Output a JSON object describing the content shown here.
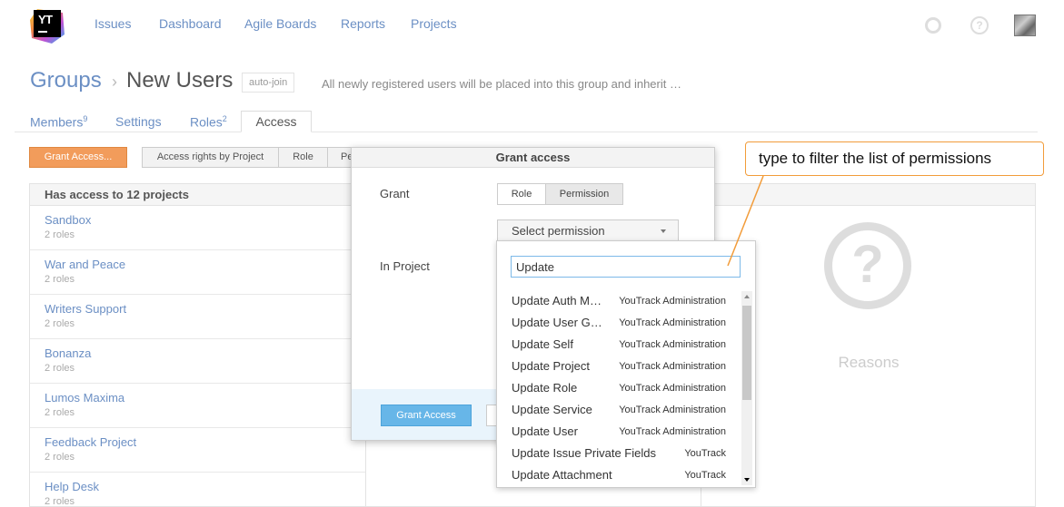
{
  "header": {
    "logo_text": "YT",
    "nav": [
      "Issues",
      "Dashboard",
      "Agile Boards",
      "Reports",
      "Projects"
    ]
  },
  "breadcrumb": {
    "parent": "Groups",
    "separator": "›",
    "current": "New Users",
    "badge": "auto-join",
    "description": "All newly registered users will be placed into this group and inherit …"
  },
  "tabs": {
    "members": "Members",
    "members_count": "9",
    "settings": "Settings",
    "roles": "Roles",
    "roles_count": "2",
    "access": "Access"
  },
  "toolbar": {
    "grant_button": "Grant Access...",
    "segments": [
      "Access rights by Project",
      "Role",
      "Pe"
    ]
  },
  "projects_panel": {
    "heading": "Has access to 12 projects",
    "items": [
      {
        "name": "Sandbox",
        "roles": "2 roles"
      },
      {
        "name": "War and Peace",
        "roles": "2 roles"
      },
      {
        "name": "Writers Support",
        "roles": "2 roles"
      },
      {
        "name": "Bonanza",
        "roles": "2 roles"
      },
      {
        "name": "Lumos Maxima",
        "roles": "2 roles"
      },
      {
        "name": "Feedback Project",
        "roles": "2 roles"
      },
      {
        "name": "Help Desk",
        "roles": "2 roles"
      }
    ]
  },
  "reasons_panel": {
    "icon_glyph": "?",
    "label": "Reasons"
  },
  "dialog": {
    "title": "Grant access",
    "grant_label": "Grant",
    "grant_options": [
      "Role",
      "Permission"
    ],
    "selected_grant": "Permission",
    "select_placeholder": "Select permission",
    "project_label": "In Project",
    "primary_button": "Grant Access"
  },
  "dropdown": {
    "filter_value": "Update",
    "options": [
      {
        "name": "Update Auth M…",
        "category": "YouTrack Administration"
      },
      {
        "name": "Update User G…",
        "category": "YouTrack Administration"
      },
      {
        "name": "Update Self",
        "category": "YouTrack Administration"
      },
      {
        "name": "Update Project",
        "category": "YouTrack Administration"
      },
      {
        "name": "Update Role",
        "category": "YouTrack Administration"
      },
      {
        "name": "Update Service",
        "category": "YouTrack Administration"
      },
      {
        "name": "Update User",
        "category": "YouTrack Administration"
      },
      {
        "name": "Update Issue Private Fields",
        "category": "YouTrack"
      },
      {
        "name": "Update Attachment",
        "category": "YouTrack"
      }
    ]
  },
  "callout": {
    "text": "type to filter the list of permissions"
  },
  "colors": {
    "link": "#6b8fc4",
    "accent_orange": "#f29c5b",
    "primary_blue": "#67b6e8",
    "callout_border": "#f29c3a"
  }
}
